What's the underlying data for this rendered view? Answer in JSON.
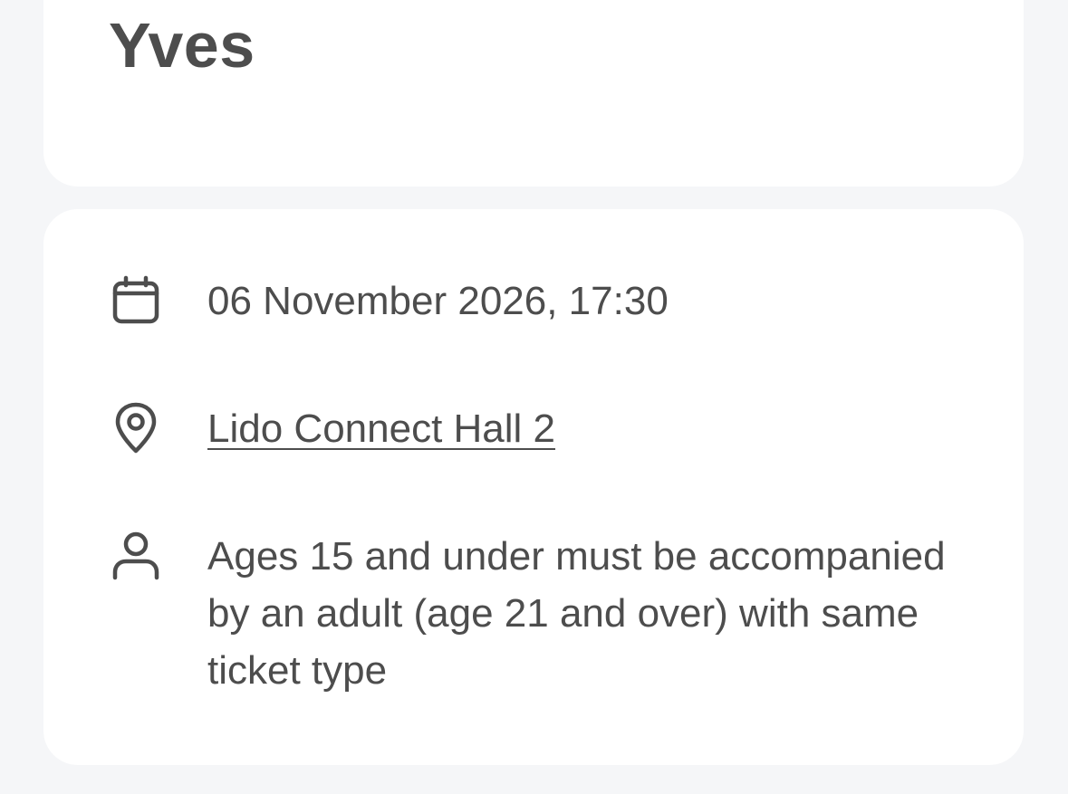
{
  "event": {
    "title": "Yves"
  },
  "details": {
    "date": {
      "icon": "calendar-icon",
      "text": "06 November 2026, 17:30"
    },
    "venue": {
      "icon": "map-pin-icon",
      "text": "Lido Connect Hall 2"
    },
    "age_restriction": {
      "icon": "person-icon",
      "text": "Ages 15 and under must be accompanied by an adult (age 21 and over) with same ticket type"
    }
  },
  "colors": {
    "background": "#f5f6f8",
    "card": "#ffffff",
    "text": "#4d4d4d"
  }
}
